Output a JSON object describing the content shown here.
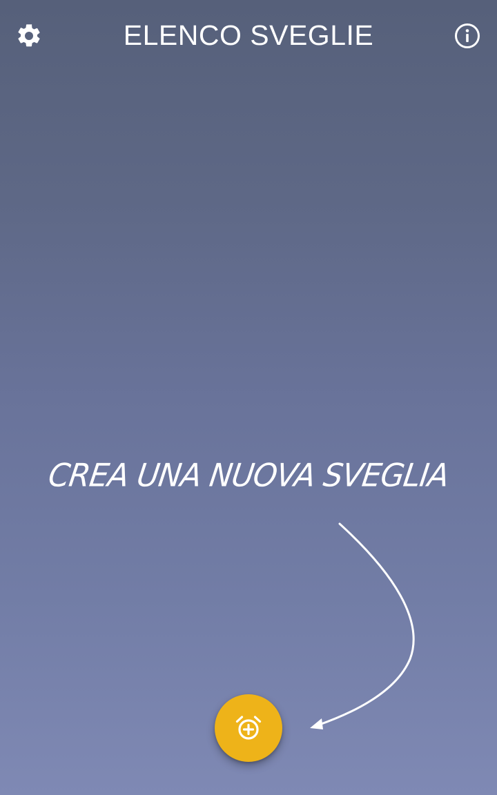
{
  "header": {
    "title": "ELENCO SVEGLIE",
    "settings_icon": "gear-icon",
    "info_icon": "info-icon"
  },
  "empty_state": {
    "hint": "CREA UNA NUOVA SVEGLIA",
    "arrow_icon": "curved-arrow-icon"
  },
  "fab": {
    "icon": "add-alarm-icon",
    "color": "#eeb319"
  },
  "colors": {
    "background_top": "#56607a",
    "background_bottom": "#7f89b4",
    "text": "#ffffff",
    "accent": "#eeb319"
  }
}
